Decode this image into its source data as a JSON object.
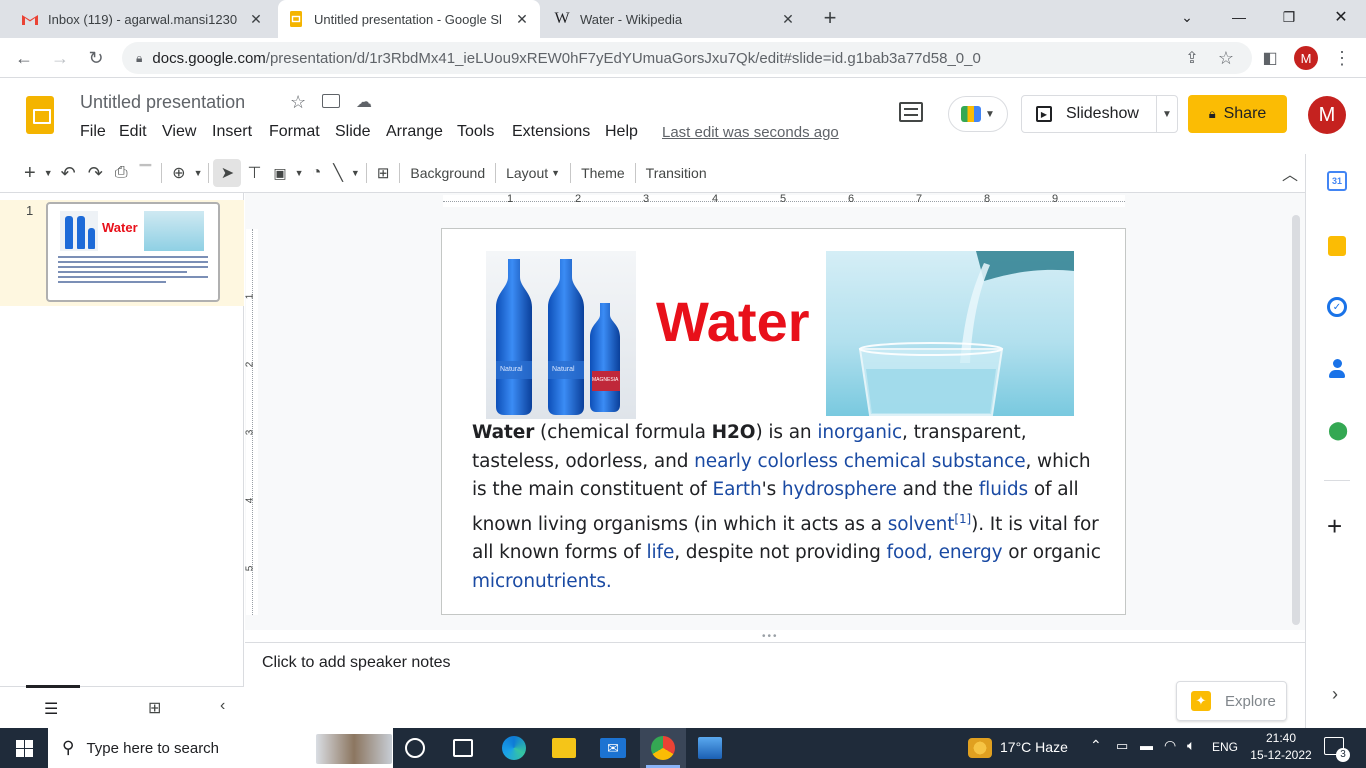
{
  "browser": {
    "tabs": [
      {
        "title": "Inbox (119) - agarwal.mansi1230"
      },
      {
        "title": "Untitled presentation - Google Sl"
      },
      {
        "title": "Water - Wikipedia"
      }
    ],
    "url_main": "docs.google.com",
    "url_rest": "/presentation/d/1r3RbdMx41_ieLUou9xREW0hF7yEdYUmuaGorsJxu7Qk/edit#slide=id.g1bab3a77d58_0_0",
    "profile_initial": "M"
  },
  "docs": {
    "title": "Untitled presentation",
    "menus": [
      "File",
      "Edit",
      "View",
      "Insert",
      "Format",
      "Slide",
      "Arrange",
      "Tools",
      "Extensions",
      "Help"
    ],
    "last_edit": "Last edit was seconds ago",
    "slideshow_label": "Slideshow",
    "share_label": "Share",
    "avatar": "M"
  },
  "toolbar": {
    "background": "Background",
    "layout": "Layout",
    "theme": "Theme",
    "transition": "Transition"
  },
  "ruler": {
    "h_ticks": [
      "1",
      "2",
      "3",
      "4",
      "5",
      "6",
      "7",
      "8",
      "9"
    ],
    "v_ticks": [
      "1",
      "2",
      "3",
      "4",
      "5"
    ]
  },
  "filmstrip": {
    "slide_number": "1",
    "thumb_title": "Water"
  },
  "slide": {
    "title": "Water",
    "bottle_labels": [
      "Natural",
      "Natural",
      "MAGNESIA"
    ],
    "body": {
      "p1_bold": "Water",
      "p1_a": " (chemical formula ",
      "p1_h2o": "H2O",
      "p1_b": ") is an ",
      "link_inorganic": "inorganic",
      "p1_c": ", transparent, tasteless, odorless, and ",
      "link_ncs": "nearly colorless chemical substance",
      "p1_d": ", which is the main constituent of ",
      "link_earth": "Earth",
      "p1_e": "'s ",
      "link_hydrosphere": "hydrosphere",
      "p1_f": " and the ",
      "link_fluids": "fluids",
      "p1_g": " of all known living organisms (in which it acts as a ",
      "link_solvent": "solvent",
      "ref": "[1]",
      "p1_h": "). It is vital for all known forms of ",
      "link_life": "life",
      "p1_i": ", despite not providing ",
      "link_food": "food",
      "p1_j": ", ",
      "link_energy": "energy",
      "p1_k": " or organic ",
      "link_micro": "micronutrients",
      "p1_l": "."
    }
  },
  "notes": {
    "placeholder": "Click to add speaker notes"
  },
  "explore_label": "Explore",
  "taskbar": {
    "search_placeholder": "Type here to search",
    "weather": "17°C  Haze",
    "lang": "ENG",
    "time": "21:40",
    "date": "15-12-2022",
    "notif_count": "3"
  },
  "colors": {
    "accent_yellow": "#fbbc04",
    "slides_yellow": "#f4b400",
    "link_blue": "#1a4aa3",
    "title_red": "#e8101a"
  }
}
